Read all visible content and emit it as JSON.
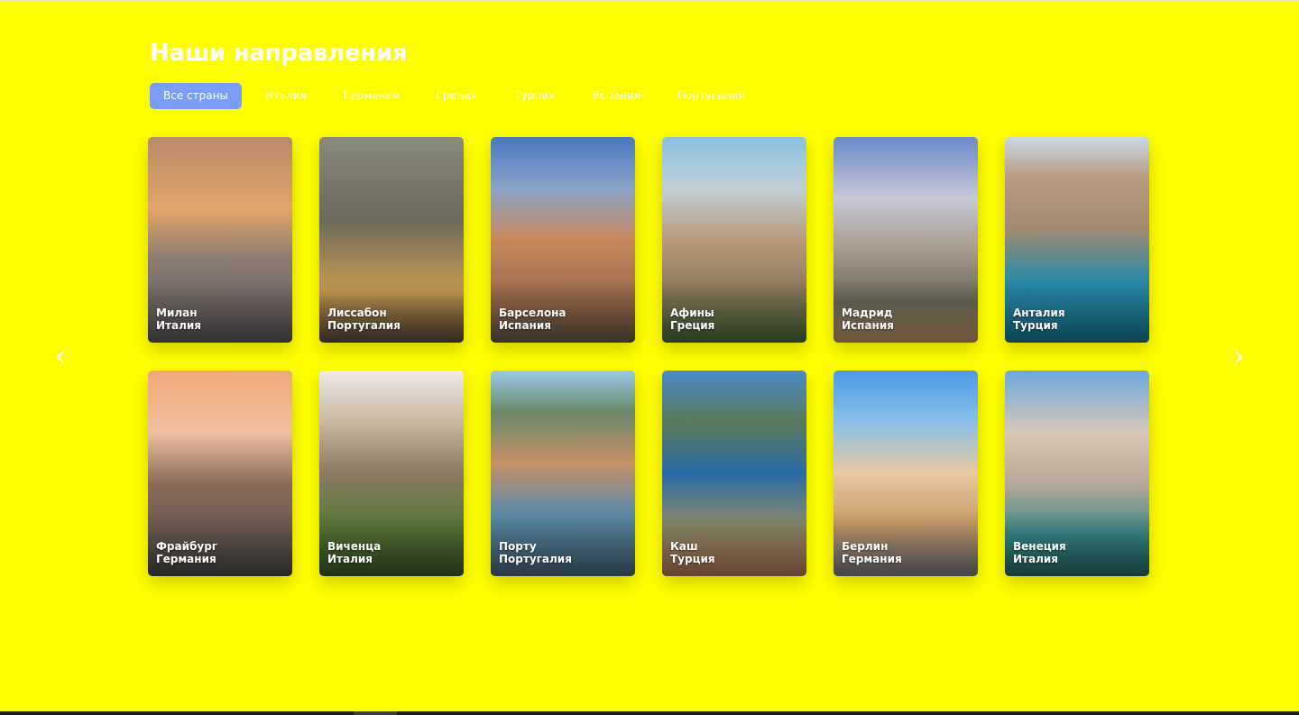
{
  "section": {
    "title": "Наши направления"
  },
  "filters": [
    "Все страны",
    "Италия",
    "Германия",
    "Греция",
    "Турция",
    "Испания",
    "Португалия"
  ],
  "active_filter": "Все страны",
  "cards": [
    {
      "city": "Милан",
      "country": "Италия"
    },
    {
      "city": "Лиссабон",
      "country": "Португалия"
    },
    {
      "city": "Барселона",
      "country": "Испания"
    },
    {
      "city": "Афины",
      "country": "Греция"
    },
    {
      "city": "Мадрид",
      "country": "Испания"
    },
    {
      "city": "Анталия",
      "country": "Турция"
    },
    {
      "city": "Фрайбург",
      "country": "Германия"
    },
    {
      "city": "Виченца",
      "country": "Италия"
    },
    {
      "city": "Порту",
      "country": "Португалия"
    },
    {
      "city": "Каш",
      "country": "Турция"
    },
    {
      "city": "Берлин",
      "country": "Германия"
    },
    {
      "city": "Венеция",
      "country": "Италия"
    }
  ],
  "colors": {
    "background": "#ffff00",
    "accent": "#7b9cf7",
    "text": "#ffffff"
  },
  "icons": {
    "prev": "chevron-left-icon",
    "next": "chevron-right-icon"
  }
}
